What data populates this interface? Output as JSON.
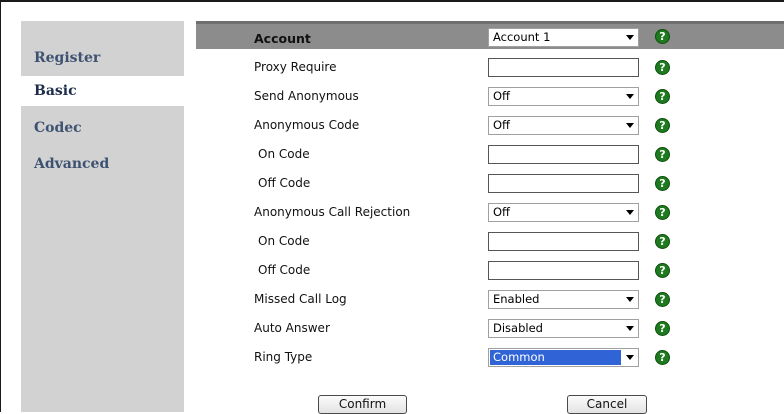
{
  "sidebar": {
    "items": [
      {
        "label": "Register"
      },
      {
        "label": "Basic"
      },
      {
        "label": "Codec"
      },
      {
        "label": "Advanced"
      }
    ],
    "active": "Basic"
  },
  "form": {
    "account": {
      "label": "Account",
      "value": "Account 1",
      "help": "?"
    },
    "proxy_require": {
      "label": "Proxy Require",
      "value": "",
      "help": "?"
    },
    "send_anonymous": {
      "label": "Send Anonymous",
      "value": "Off",
      "help": "?"
    },
    "anonymous_code": {
      "label": "Anonymous Code",
      "value": "Off",
      "help": "?"
    },
    "anon_on_code": {
      "label": "On Code",
      "value": "",
      "help": "?"
    },
    "anon_off_code": {
      "label": "Off Code",
      "value": "",
      "help": "?"
    },
    "anonymous_call_rejection": {
      "label": "Anonymous Call Rejection",
      "value": "Off",
      "help": "?"
    },
    "rej_on_code": {
      "label": "On Code",
      "value": "",
      "help": "?"
    },
    "rej_off_code": {
      "label": "Off Code",
      "value": "",
      "help": "?"
    },
    "missed_call_log": {
      "label": "Missed Call Log",
      "value": "Enabled",
      "help": "?"
    },
    "auto_answer": {
      "label": "Auto Answer",
      "value": "Disabled",
      "help": "?"
    },
    "ring_type": {
      "label": "Ring Type",
      "value": "Common",
      "help": "?"
    }
  },
  "buttons": {
    "confirm": "Confirm",
    "cancel": "Cancel"
  },
  "colors": {
    "sidebar_bg": "#d2d2d2",
    "header_bg": "#8c8c8c",
    "help_icon": "#1e7a1e",
    "selection": "#2f63d6"
  }
}
